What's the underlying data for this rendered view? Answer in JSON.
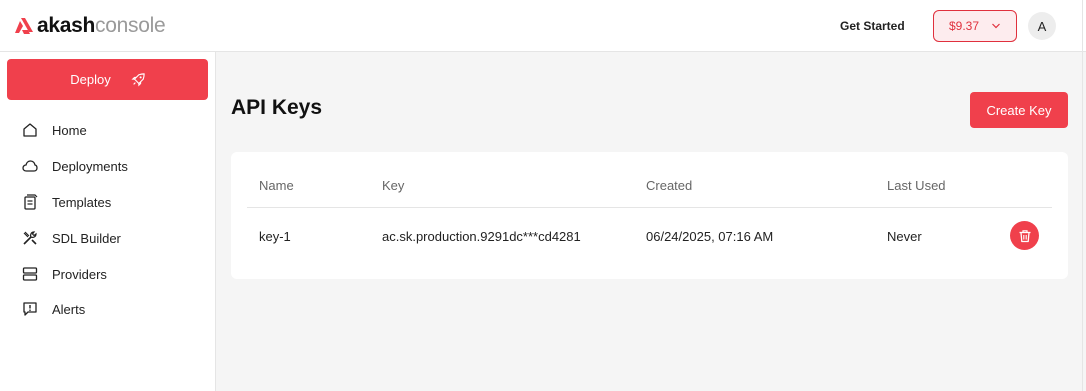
{
  "header": {
    "brand_bold": "akash",
    "brand_light": "console",
    "get_started": "Get Started",
    "balance": "$9.37",
    "avatar_initial": "A"
  },
  "sidebar": {
    "deploy_label": "Deploy",
    "items": [
      {
        "label": "Home",
        "icon": "home-icon"
      },
      {
        "label": "Deployments",
        "icon": "cloud-icon"
      },
      {
        "label": "Templates",
        "icon": "templates-icon"
      },
      {
        "label": "SDL Builder",
        "icon": "tools-icon"
      },
      {
        "label": "Providers",
        "icon": "server-icon"
      },
      {
        "label": "Alerts",
        "icon": "alert-icon"
      }
    ]
  },
  "main": {
    "title": "API Keys",
    "create_key": "Create Key",
    "table": {
      "columns": [
        "Name",
        "Key",
        "Created",
        "Last Used"
      ],
      "rows": [
        {
          "name": "key-1",
          "key": "ac.sk.production.9291dc***cd4281",
          "created": "06/24/2025, 07:16 AM",
          "last_used": "Never"
        }
      ]
    }
  },
  "colors": {
    "accent": "#f0404c",
    "background": "#f5f5f5"
  }
}
